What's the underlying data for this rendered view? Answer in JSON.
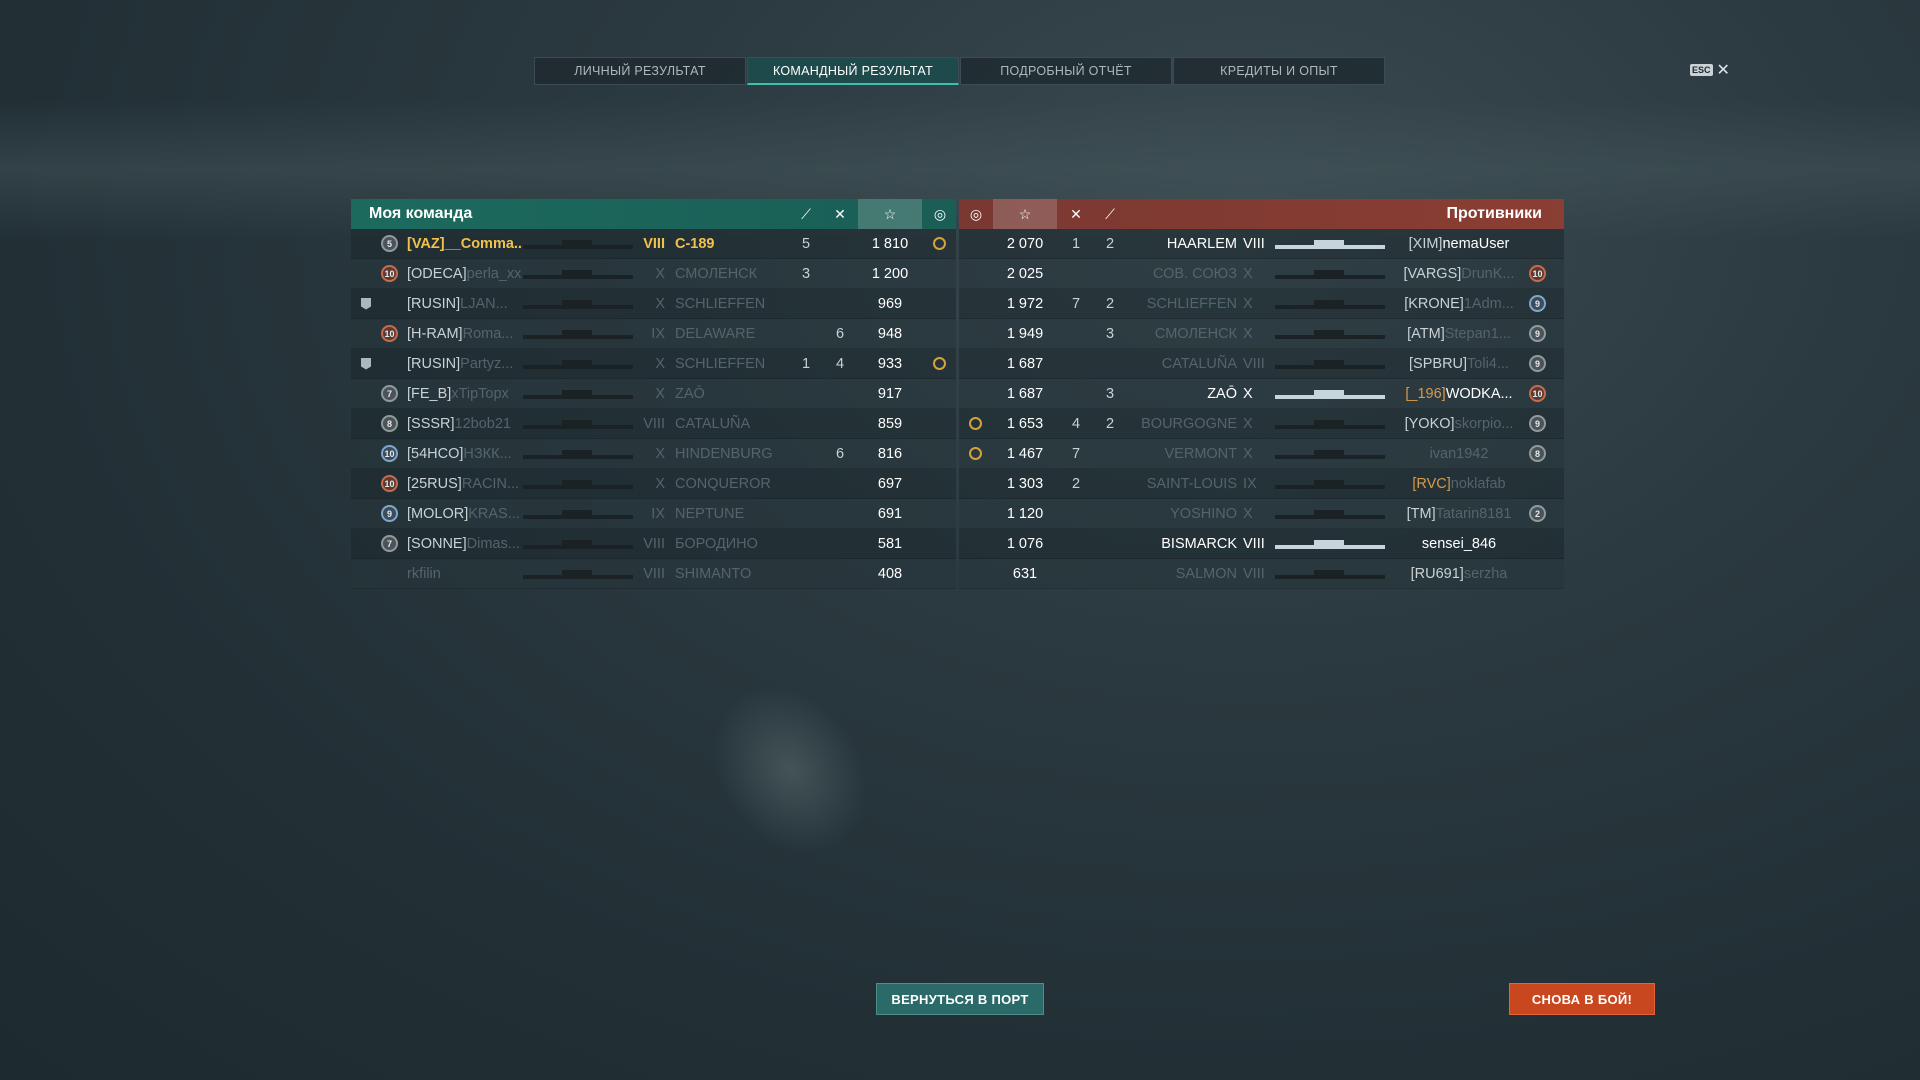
{
  "tabs": [
    "ЛИЧНЫЙ РЕЗУЛЬТАТ",
    "КОМАНДНЫЙ РЕЗУЛЬТАТ",
    "ПОДРОБНЫЙ ОТЧЁТ",
    "КРЕДИТЫ И ОПЫТ"
  ],
  "active_tab": 1,
  "esc": {
    "key": "ESC",
    "close": "✕"
  },
  "my_team": {
    "title": "Моя команда",
    "rows": [
      {
        "rank": "5",
        "clan": "[VAZ]",
        "name": "__Comma...",
        "tier": "VIII",
        "ship": "С-189",
        "a": "5",
        "b": "",
        "score": "1 810",
        "medal": true,
        "self": true
      },
      {
        "rank": "10",
        "clan": "[ODECA]",
        "name": "perla_xx",
        "tier": "X",
        "ship": "СМОЛЕНСК",
        "a": "3",
        "b": "",
        "score": "1 200",
        "medal": false
      },
      {
        "rank": "",
        "clan": "[RUSIN]",
        "name": "LJAN...",
        "tier": "X",
        "ship": "SCHLIEFFEN",
        "a": "",
        "b": "",
        "score": "969",
        "medal": false,
        "flag": true
      },
      {
        "rank": "10",
        "clan": "[H-RAM]",
        "name": "Roma...",
        "tier": "IX",
        "ship": "DELAWARE",
        "a": "",
        "b": "6",
        "score": "948",
        "medal": false
      },
      {
        "rank": "",
        "clan": "[RUSIN]",
        "name": "Partyz...",
        "tier": "X",
        "ship": "SCHLIEFFEN",
        "a": "1",
        "b": "4",
        "score": "933",
        "medal": true,
        "flag": true
      },
      {
        "rank": "7",
        "clan": "[FE_B]",
        "name": "xTipTopx",
        "tier": "X",
        "ship": "ZAŌ",
        "a": "",
        "b": "",
        "score": "917",
        "medal": false
      },
      {
        "rank": "8",
        "clan": "[SSSR]",
        "name": "12bob21",
        "tier": "VIII",
        "ship": "CATALUÑA",
        "a": "",
        "b": "",
        "score": "859",
        "medal": false
      },
      {
        "rank": "10",
        "clan": "[54HCO]",
        "name": "НЗКК...",
        "tier": "X",
        "ship": "HINDENBURG",
        "a": "",
        "b": "6",
        "score": "816",
        "medal": false,
        "blue": true
      },
      {
        "rank": "10",
        "clan": "[25RUS]",
        "name": "RACIN...",
        "tier": "X",
        "ship": "CONQUEROR",
        "a": "",
        "b": "",
        "score": "697",
        "medal": false
      },
      {
        "rank": "9",
        "clan": "[MOLOR]",
        "name": "KRAS...",
        "tier": "IX",
        "ship": "NEPTUNE",
        "a": "",
        "b": "",
        "score": "691",
        "medal": false,
        "blue": true
      },
      {
        "rank": "7",
        "clan": "[SONNE]",
        "name": "Dimas...",
        "tier": "VIII",
        "ship": "БОРОДИНО",
        "a": "",
        "b": "",
        "score": "581",
        "medal": false
      },
      {
        "rank": "",
        "clan": "",
        "name": "rkfilin",
        "tier": "VIII",
        "ship": "SHIMANTO",
        "a": "",
        "b": "",
        "score": "408",
        "medal": false
      }
    ]
  },
  "enemies": {
    "title": "Противники",
    "rows": [
      {
        "medal": false,
        "score": "2 070",
        "a": "1",
        "b": "2",
        "ship": "HAARLEM",
        "tier": "VIII",
        "clan": "[XIM]",
        "name": "nemaUser",
        "rank": "",
        "alive": true
      },
      {
        "medal": false,
        "score": "2 025",
        "a": "",
        "b": "",
        "ship": "СОВ. СОЮЗ",
        "tier": "X",
        "clan": "[VARGS]",
        "name": "DrunK...",
        "rank": "10"
      },
      {
        "medal": false,
        "score": "1 972",
        "a": "7",
        "b": "2",
        "ship": "SCHLIEFFEN",
        "tier": "X",
        "clan": "[KRONE]",
        "name": "1Adm...",
        "rank": "9",
        "blue": true
      },
      {
        "medal": false,
        "score": "1 949",
        "a": "",
        "b": "3",
        "ship": "СМОЛЕНСК",
        "tier": "X",
        "clan": "[ATM]",
        "name": "Stepan1...",
        "rank": "9"
      },
      {
        "medal": false,
        "score": "1 687",
        "a": "",
        "b": "",
        "ship": "CATALUÑA",
        "tier": "VIII",
        "clan": "[SPBRU]",
        "name": "Toli4...",
        "rank": "9"
      },
      {
        "medal": false,
        "score": "1 687",
        "a": "",
        "b": "3",
        "ship": "ZAŌ",
        "tier": "X",
        "clan": "[_196]",
        "name": "WODKA...",
        "rank": "10",
        "alive": true,
        "orange": true
      },
      {
        "medal": true,
        "score": "1 653",
        "a": "4",
        "b": "2",
        "ship": "BOURGOGNE",
        "tier": "X",
        "clan": "[YOKO]",
        "name": "skorpio...",
        "rank": "9"
      },
      {
        "medal": true,
        "score": "1 467",
        "a": "7",
        "b": "",
        "ship": "VERMONT",
        "tier": "X",
        "clan": "",
        "name": "ivan1942",
        "rank": "8"
      },
      {
        "medal": false,
        "score": "1 303",
        "a": "2",
        "b": "",
        "ship": "SAINT-LOUIS",
        "tier": "IX",
        "clan": "[RVC]",
        "name": "noklafab",
        "rank": "",
        "orange": true
      },
      {
        "medal": false,
        "score": "1 120",
        "a": "",
        "b": "",
        "ship": "YOSHINO",
        "tier": "X",
        "clan": "[TM]",
        "name": "Tatarin8181",
        "rank": "2"
      },
      {
        "medal": false,
        "score": "1 076",
        "a": "",
        "b": "",
        "ship": "BISMARCK",
        "tier": "VIII",
        "clan": "",
        "name": "sensei_846",
        "rank": "",
        "alive": true
      },
      {
        "medal": false,
        "score": "631",
        "a": "",
        "b": "",
        "ship": "SALMON",
        "tier": "VIII",
        "clan": "[RU691]",
        "name": "serzha",
        "rank": ""
      }
    ]
  },
  "buttons": {
    "port": "ВЕРНУТЬСЯ В ПОРТ",
    "battle": "СНОВА В БОЙ!"
  },
  "colors": {
    "my_team": "#1c6a5e",
    "enemies": "#8b3e33",
    "battle_button": "#c9471f",
    "port_button": "#2c6a6a"
  }
}
